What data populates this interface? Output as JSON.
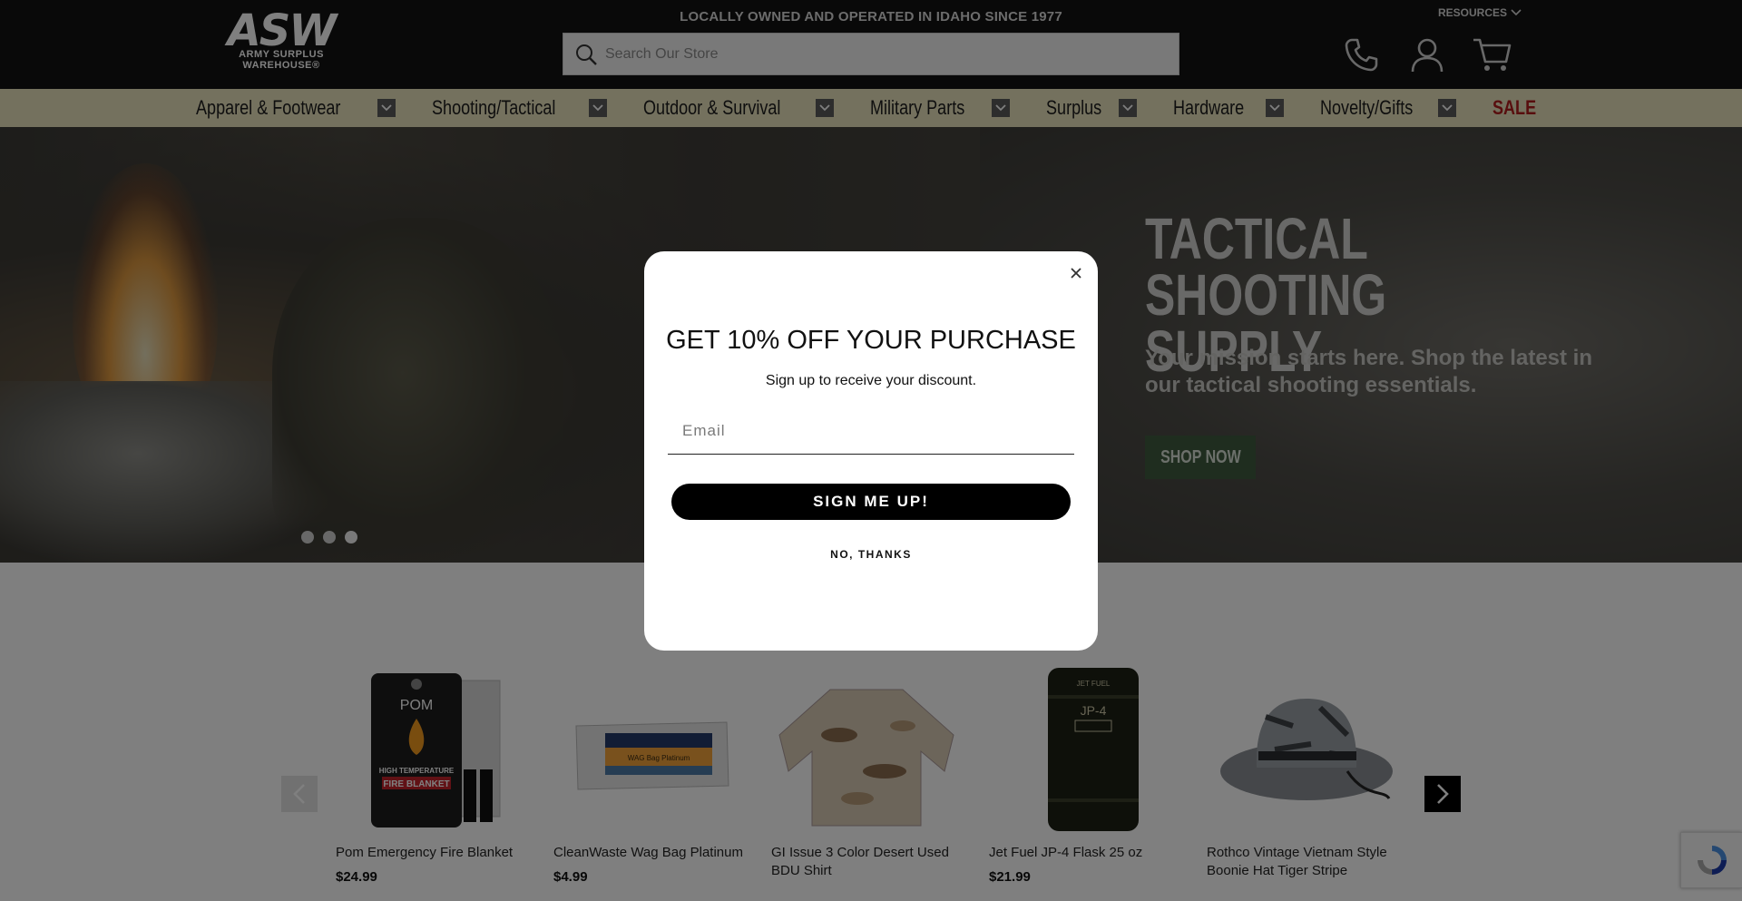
{
  "header": {
    "logo_main": "ASW",
    "logo_line1": "ARMY SURPLUS",
    "logo_line2": "WAREHOUSE®",
    "tagline": "LOCALLY OWNED AND OPERATED IN IDAHO SINCE 1977",
    "resources_label": "RESOURCES",
    "search_placeholder": "Search Our Store",
    "icons": [
      "phone-icon",
      "account-icon",
      "cart-icon"
    ]
  },
  "nav": {
    "items": [
      {
        "label": "Apparel & Footwear"
      },
      {
        "label": "Shooting/Tactical"
      },
      {
        "label": "Outdoor & Survival"
      },
      {
        "label": "Military Parts"
      },
      {
        "label": "Surplus"
      },
      {
        "label": "Hardware"
      },
      {
        "label": "Novelty/Gifts"
      }
    ],
    "sale_label": "SALE",
    "sale_color": "#b11c1c"
  },
  "hero": {
    "title": "TACTICAL SHOOTING SUPPLY",
    "subtitle": "Your mission starts here. Shop the latest in our tactical shooting essentials.",
    "cta_label": "SHOP NOW",
    "slides_count": 3,
    "active_slide": 3
  },
  "products": [
    {
      "name": "Pom Emergency Fire Blanket",
      "price": "$24.99"
    },
    {
      "name": "CleanWaste Wag Bag Platinum",
      "price": "$4.99"
    },
    {
      "name": "GI Issue 3 Color Desert Used BDU Shirt",
      "price": ""
    },
    {
      "name": "Jet Fuel JP-4 Flask 25 oz",
      "price": "$21.99"
    },
    {
      "name": "Rothco Vintage Vietnam Style Boonie Hat Tiger Stripe",
      "price": ""
    }
  ],
  "product_art": {
    "blanket_brand": "POM",
    "blanket_line1": "HIGH TEMPERATURE",
    "blanket_line2": "FIRE BLANKET",
    "wag_label": "WAG Bag Platinum",
    "flask_line1": "JET FUEL",
    "flask_line2": "JP-4"
  },
  "modal": {
    "title": "GET 10% OFF YOUR PURCHASE",
    "subtitle": "Sign up to receive your discount.",
    "email_placeholder": "Email",
    "submit_label": "SIGN ME UP!",
    "decline_label": "NO, THANKS"
  },
  "colors": {
    "header_bg": "#121212",
    "nav_bg": "#e8e2bd",
    "cta_green": "#3f5a3e"
  }
}
